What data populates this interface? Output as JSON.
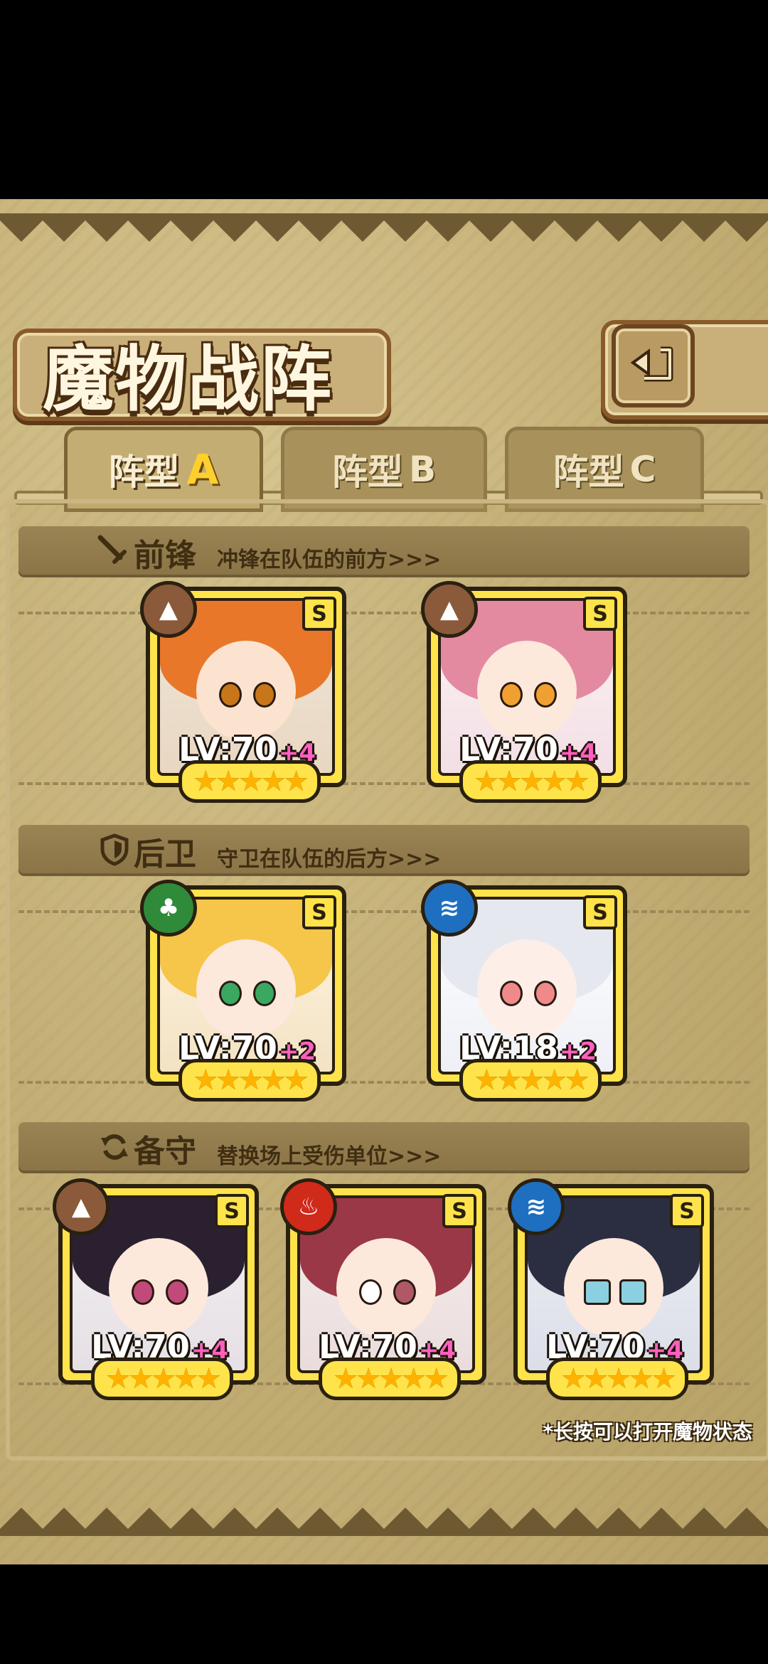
{
  "header": {
    "title": "魔物战阵",
    "back_icon": "return-icon"
  },
  "tabs": [
    {
      "prefix": "阵型",
      "letter": "A",
      "active": true
    },
    {
      "prefix": "阵型",
      "letter": "B",
      "active": false
    },
    {
      "prefix": "阵型",
      "letter": "C",
      "active": false
    }
  ],
  "sections": {
    "front": {
      "title": "前锋",
      "desc": "冲锋在队伍的前方>>>",
      "icon": "sword-icon"
    },
    "rear": {
      "title": "后卫",
      "desc": "守卫在队伍的后方>>>",
      "icon": "shield-icon"
    },
    "reserve": {
      "title": "备守",
      "desc": "替换场上受伤单位>>>",
      "icon": "swap-icon"
    }
  },
  "cards": {
    "front1": {
      "lv": "LV:70",
      "plus": "+4",
      "grade": "S",
      "stars": "★★★★★",
      "element": "earth",
      "color": "#8a5a3a"
    },
    "front2": {
      "lv": "LV:70",
      "plus": "+4",
      "grade": "S",
      "stars": "★★★★★",
      "element": "earth",
      "color": "#8a5a3a"
    },
    "rear1": {
      "lv": "LV:70",
      "plus": "+2",
      "grade": "S",
      "stars": "★★★★★",
      "element": "wind",
      "color": "#2f8a3a"
    },
    "rear2": {
      "lv": "LV:18",
      "plus": "+2",
      "grade": "S",
      "stars": "★★★★★",
      "element": "water",
      "color": "#1f6fc0"
    },
    "reserve1": {
      "lv": "LV:70",
      "plus": "+4",
      "grade": "S",
      "stars": "★★★★★",
      "element": "earth",
      "color": "#8a5a3a"
    },
    "reserve2": {
      "lv": "LV:70",
      "plus": "+4",
      "grade": "S",
      "stars": "★★★★★",
      "element": "fire",
      "color": "#d02a1a"
    },
    "reserve3": {
      "lv": "LV:70",
      "plus": "+4",
      "grade": "S",
      "stars": "★★★★★",
      "element": "water",
      "color": "#1f6fc0"
    }
  },
  "hint": "*长按可以打开魔物状态"
}
